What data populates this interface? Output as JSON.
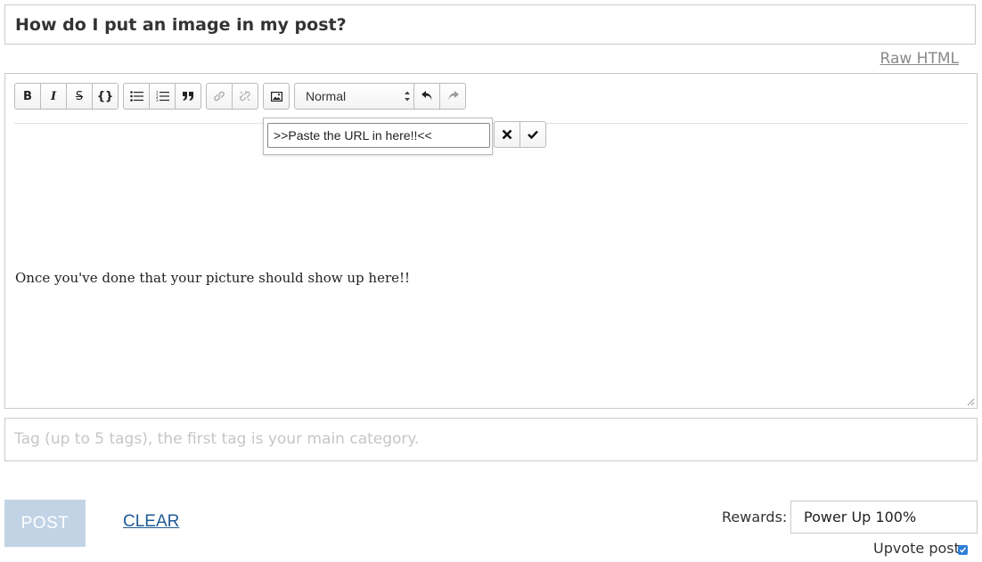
{
  "title_field": {
    "value": "How do I put an image in my post?"
  },
  "raw_html_link": "Raw HTML",
  "toolbar": {
    "bold_label": "B",
    "italic_label": "I",
    "strike_label": "S",
    "code_label": "{}",
    "format_select": "Normal",
    "icons": [
      "bold-icon",
      "italic-icon",
      "strikethrough-icon",
      "code-icon",
      "bullet-list-icon",
      "numbered-list-icon",
      "quote-icon",
      "link-icon",
      "unlink-icon",
      "image-icon",
      "undo-icon",
      "redo-icon"
    ]
  },
  "image_popup": {
    "url_value": ">>Paste the URL in here!!<<",
    "icons": [
      "close-icon",
      "check-icon"
    ]
  },
  "editor": {
    "body_text": "Once you've done that your picture should show up here!!"
  },
  "tags_field": {
    "placeholder": "Tag (up to 5 tags), the first tag is your main category."
  },
  "actions": {
    "post_label": "POST",
    "clear_label": "CLEAR"
  },
  "rewards": {
    "label": "Rewards:",
    "selected": "Power Up 100%"
  },
  "upvote": {
    "label": "Upvote post",
    "checked": true
  },
  "colors": {
    "post_button_bg": "#c2d3e6",
    "clear_link": "#1f5a93",
    "checkbox": "#2d7fd8"
  }
}
